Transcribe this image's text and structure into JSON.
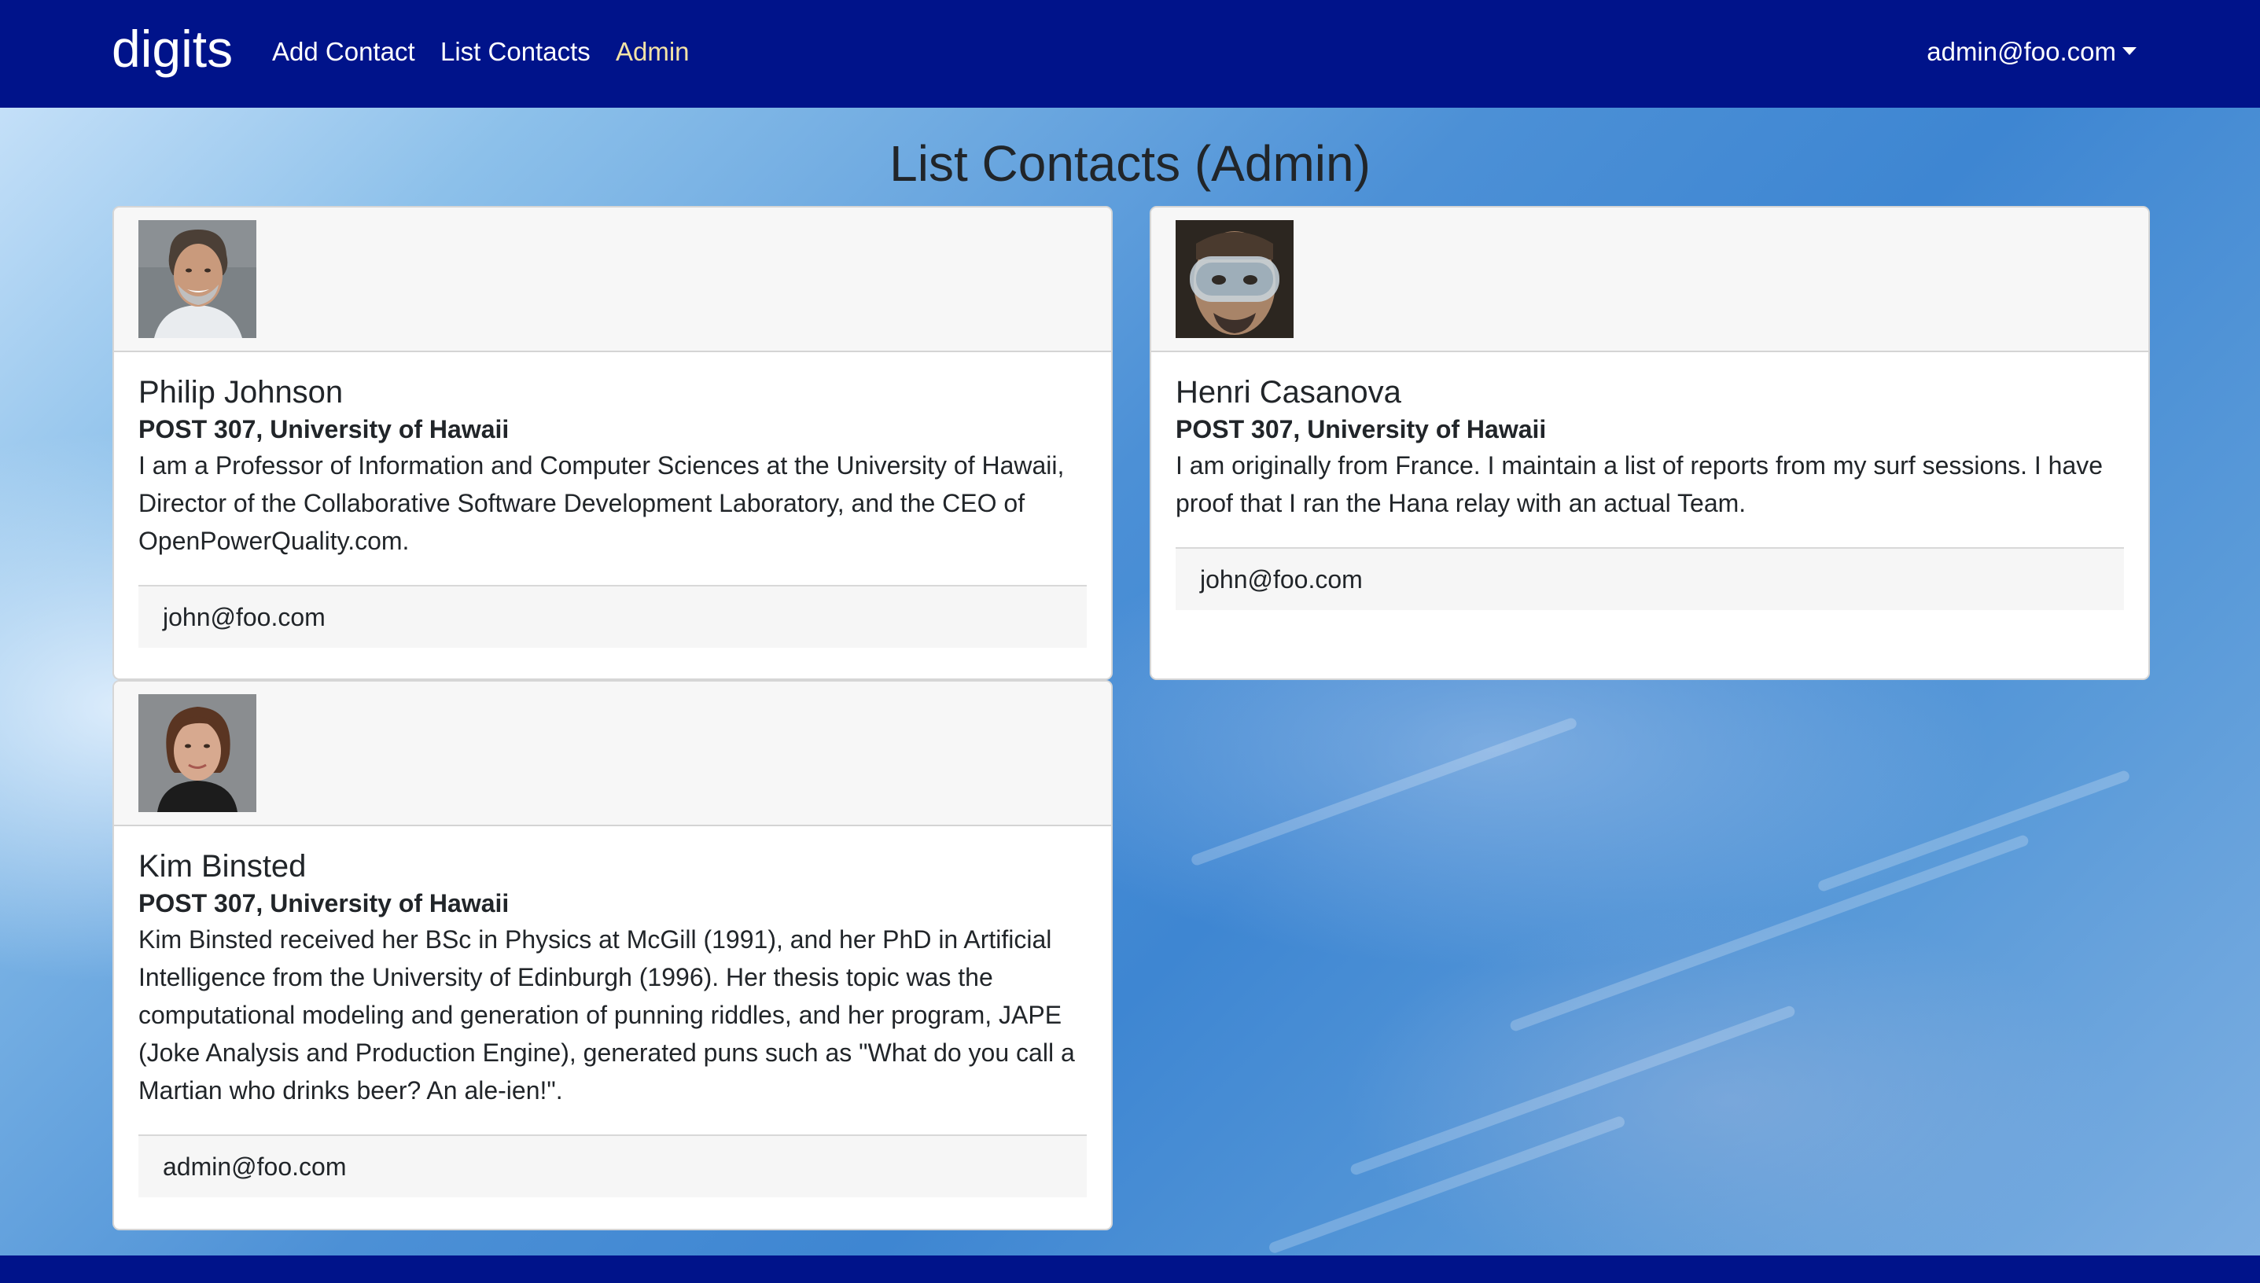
{
  "navbar": {
    "brand": "digits",
    "links": [
      "Add Contact",
      "List Contacts",
      "Admin"
    ],
    "user": "admin@foo.com",
    "colors": {
      "background": "#00138a",
      "active_link": "#f3e3a6"
    }
  },
  "page": {
    "title": "List Contacts (Admin)"
  },
  "contacts": [
    {
      "name": "Philip Johnson",
      "address": "POST 307, University of Hawaii",
      "description": "I am a Professor of Information and Computer Sciences at the University of Hawaii, Director of the Collaborative Software Development Laboratory, and the CEO of OpenPowerQuality.com.",
      "owner": "john@foo.com",
      "avatar_icon": "man-portrait-photo"
    },
    {
      "name": "Henri Casanova",
      "address": "POST 307, University of Hawaii",
      "description": "I am originally from France. I maintain a list of reports from my surf sessions. I have proof that I ran the Hana relay with an actual Team.",
      "owner": "john@foo.com",
      "avatar_icon": "man-in-goggles-photo"
    },
    {
      "name": "Kim Binsted",
      "address": "POST 307, University of Hawaii",
      "description": "Kim Binsted received her BSc in Physics at McGill (1991), and her PhD in Artificial Intelligence from the University of Edinburgh (1996). Her thesis topic was the computational modeling and generation of punning riddles, and her program, JAPE (Joke Analysis and Production Engine), generated puns such as \"What do you call a Martian who drinks beer? An ale-ien!\".",
      "owner": "admin@foo.com",
      "avatar_icon": "woman-portrait-photo"
    }
  ]
}
